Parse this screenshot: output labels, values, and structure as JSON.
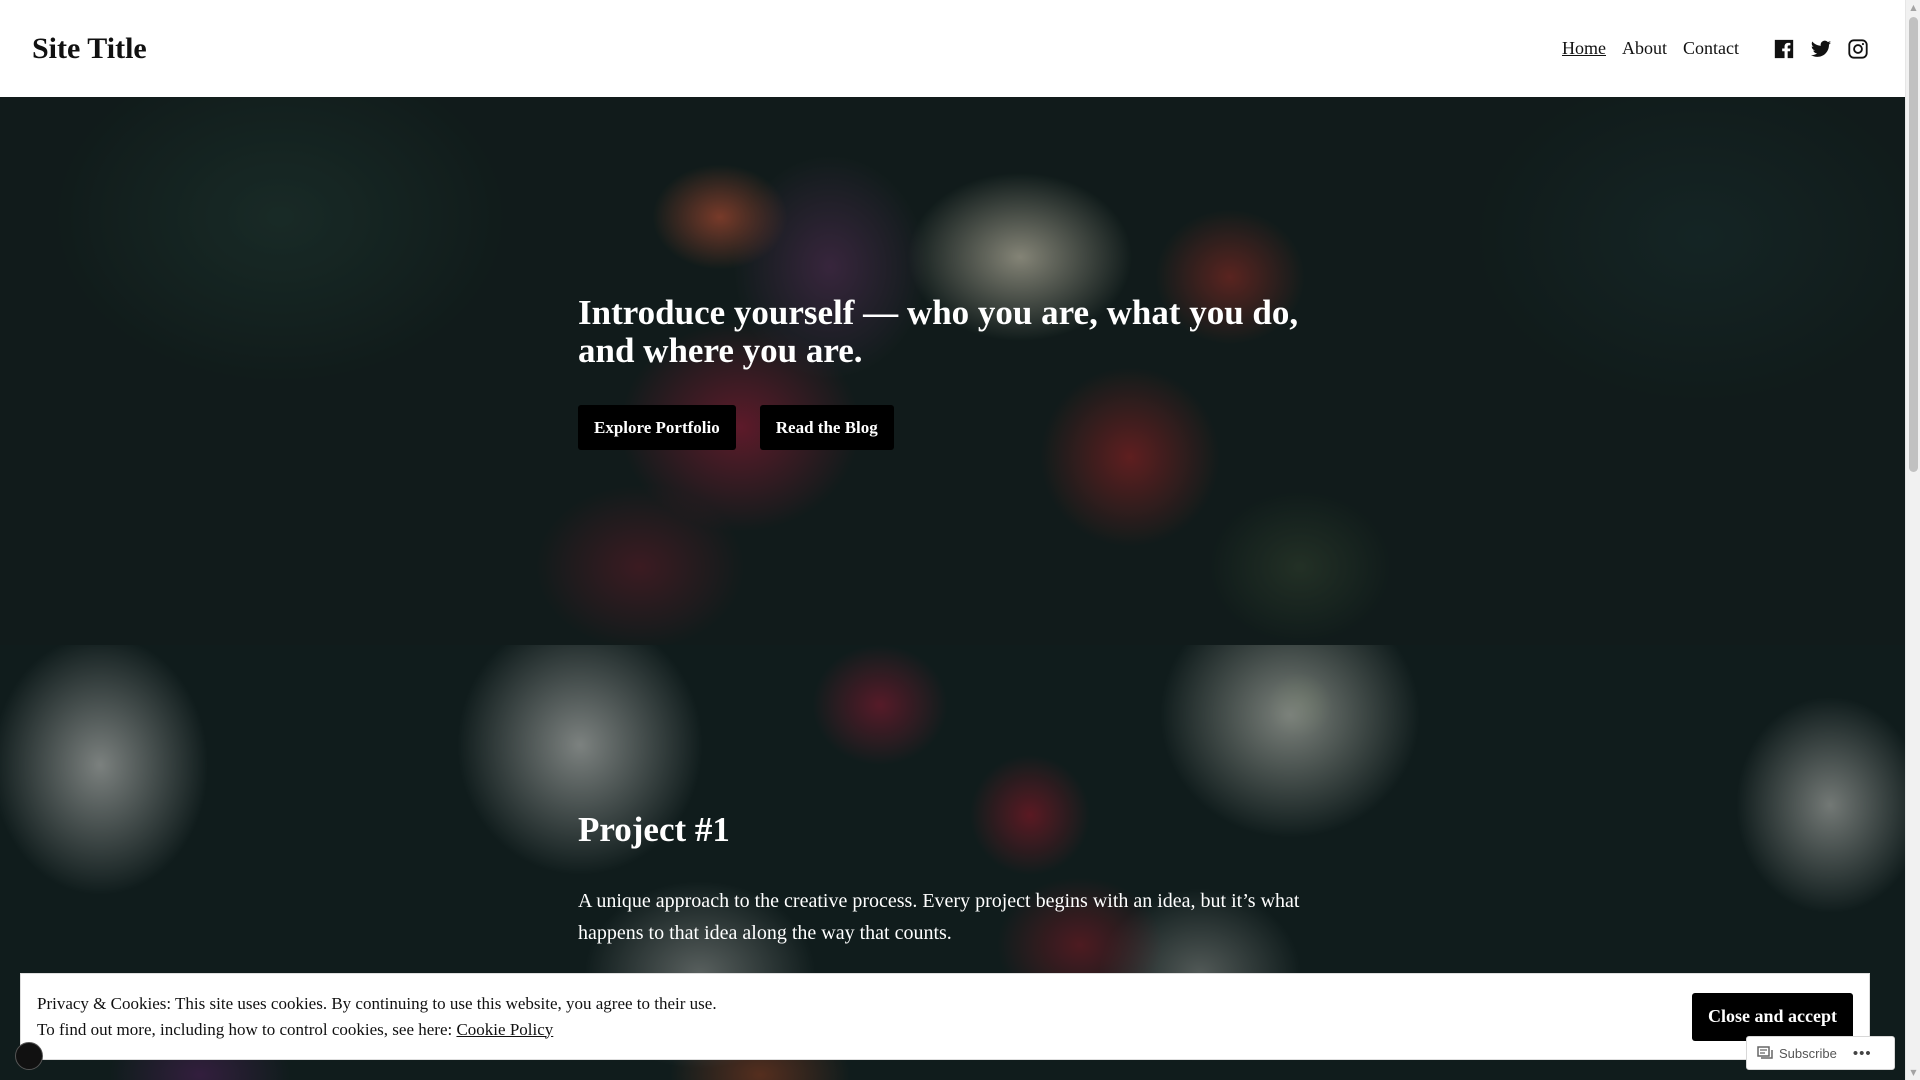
{
  "header": {
    "site_title": "Site Title",
    "nav": [
      {
        "label": "Home",
        "current": true
      },
      {
        "label": "About",
        "current": false
      },
      {
        "label": "Contact",
        "current": false
      }
    ],
    "social_icons": [
      "facebook-icon",
      "twitter-icon",
      "instagram-icon"
    ]
  },
  "hero": {
    "heading": "Introduce yourself — who you are, what you do, and where you are.",
    "buttons": [
      "Explore Portfolio",
      "Read the Blog"
    ]
  },
  "project": {
    "title": "Project #1",
    "text": "A unique approach to the creative process. Every project begins with an idea, but it’s what happens to that idea along the way that counts."
  },
  "cookie": {
    "line1": "Privacy & Cookies: This site uses cookies. By continuing to use this website, you agree to their use.",
    "line2_prefix": "To find out more, including how to control cookies, see here: ",
    "policy_link": "Cookie Policy",
    "close_button": "Close and accept"
  },
  "subscribe": {
    "label": "Subscribe",
    "more": "•••"
  },
  "colors": {
    "button_bg": "#000000",
    "button_text": "#ffffff",
    "header_bg": "#ffffff"
  }
}
